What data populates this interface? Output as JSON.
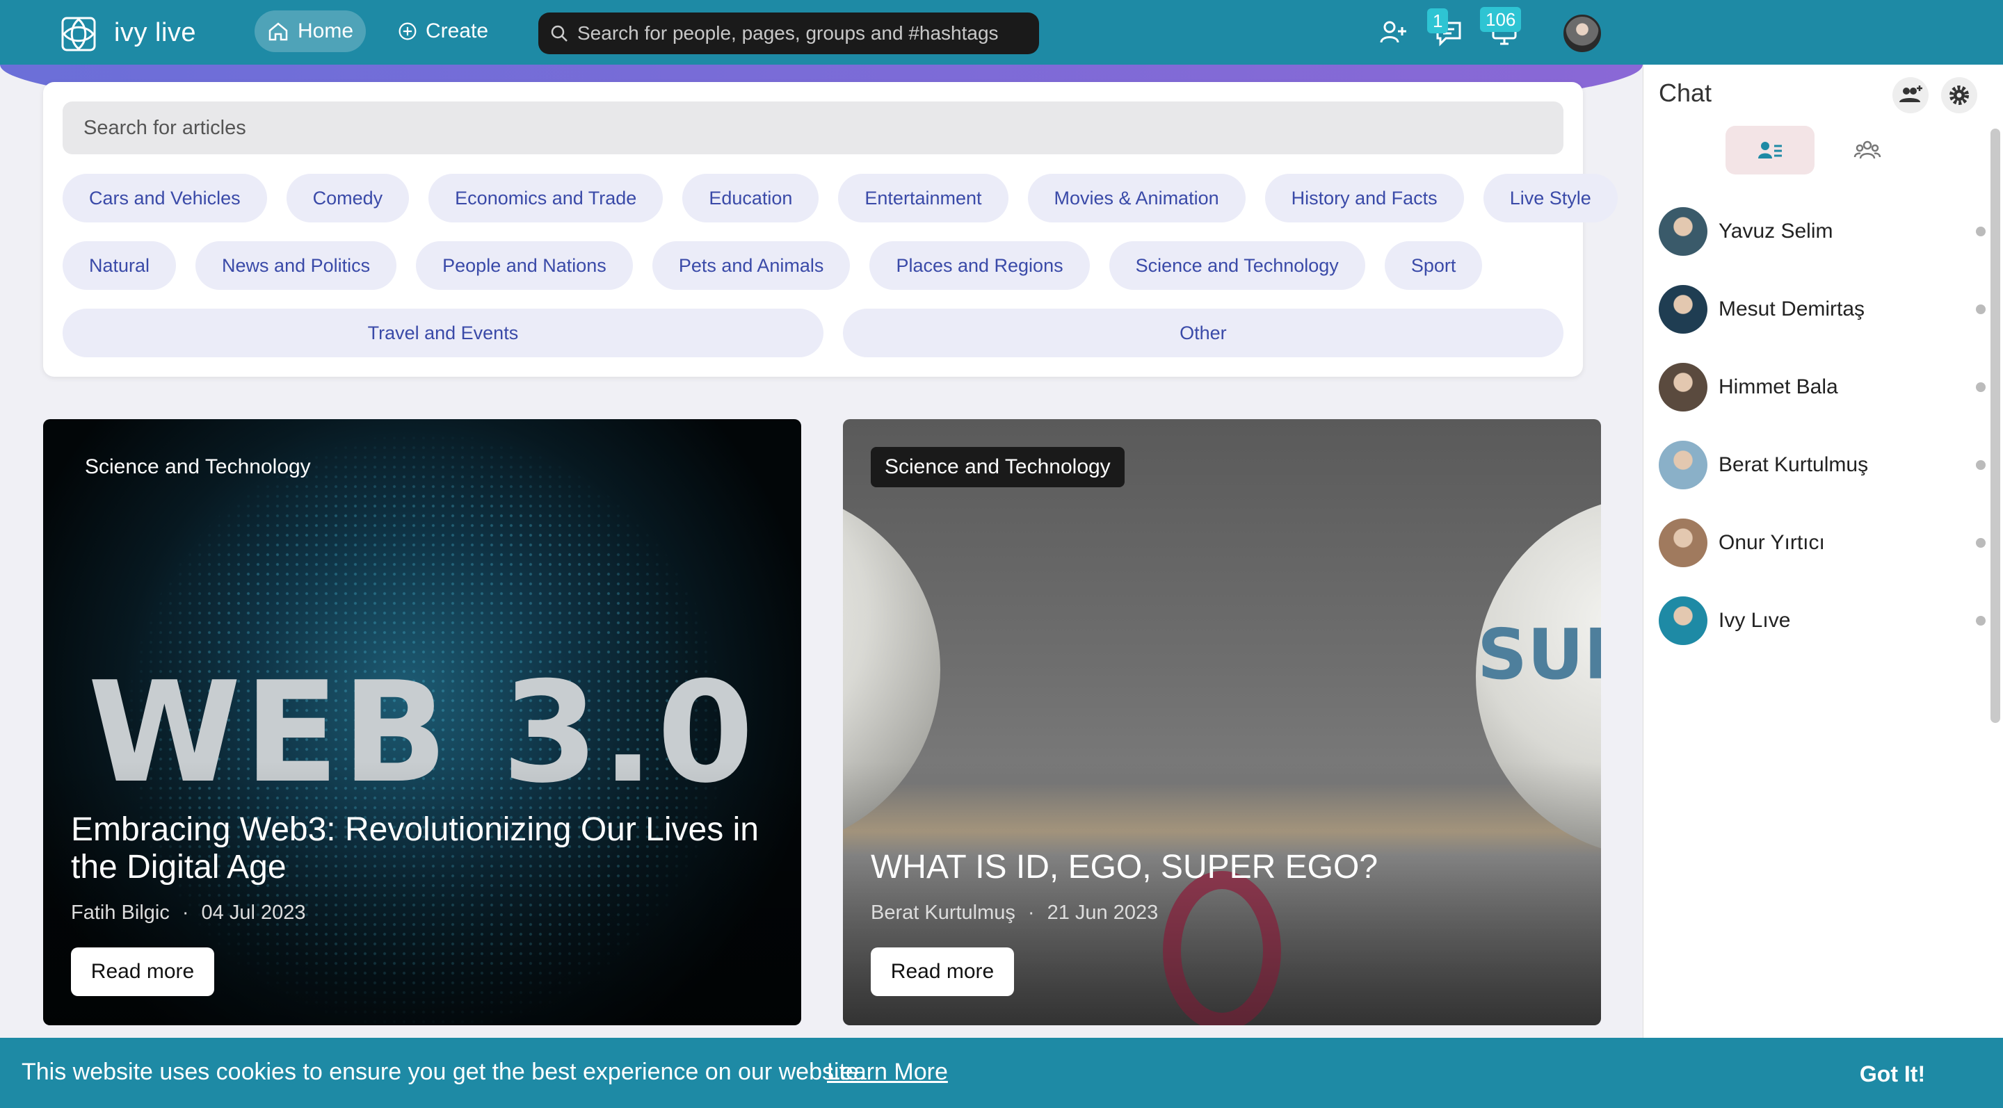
{
  "app": {
    "brand": "ivy live"
  },
  "nav": {
    "home_label": "Home",
    "create_label": "Create",
    "search_placeholder": "Search for people, pages, groups and #hashtags",
    "messages_badge": "1",
    "notifications_badge": "106"
  },
  "articles": {
    "search_placeholder": "Search for articles",
    "categories_row1": [
      "Cars and Vehicles",
      "Comedy",
      "Economics and Trade",
      "Education",
      "Entertainment",
      "Movies & Animation",
      "History and Facts",
      "Live Style"
    ],
    "categories_row2": [
      "Natural",
      "News and Politics",
      "People and Nations",
      "Pets and Animals",
      "Places and Regions",
      "Science and Technology",
      "Sport"
    ],
    "categories_row3": [
      "Travel and Events",
      "Other"
    ]
  },
  "cards": [
    {
      "tag": "Science and Technology",
      "image_text": "WEB 3.0",
      "title": "Embracing Web3: Revolutionizing Our Lives in the Digital Age",
      "author": "Fatih Bilgic",
      "date": "04 Jul 2023",
      "separator": "·",
      "read_more": "Read more"
    },
    {
      "tag": "Science and Technology",
      "image_text": "SUP",
      "title": "WHAT IS ID, EGO, SUPER EGO?",
      "author": "Berat Kurtulmuş",
      "date": "21 Jun 2023",
      "separator": "·",
      "read_more": "Read more"
    }
  ],
  "chat": {
    "title": "Chat",
    "contacts": [
      {
        "name": "Yavuz Selim",
        "color": "#3a5a6a"
      },
      {
        "name": "Mesut Demirtaş",
        "color": "#1f3d52"
      },
      {
        "name": "Himmet Bala",
        "color": "#5a4a3e"
      },
      {
        "name": "Berat Kurtulmuş",
        "color": "#8ab0c8"
      },
      {
        "name": "Onur Yırtıcı",
        "color": "#a07a5e"
      },
      {
        "name": "Ivy Lıve",
        "color": "#1e8aa5"
      }
    ]
  },
  "cookie": {
    "message": "This website uses cookies to ensure you get the best experience on our website.",
    "learn_more": "Learn More",
    "accept": "Got It!"
  },
  "colors": {
    "primary": "#1e8aa5",
    "category_text": "#3a4aa8",
    "category_bg": "#ebecf8"
  }
}
